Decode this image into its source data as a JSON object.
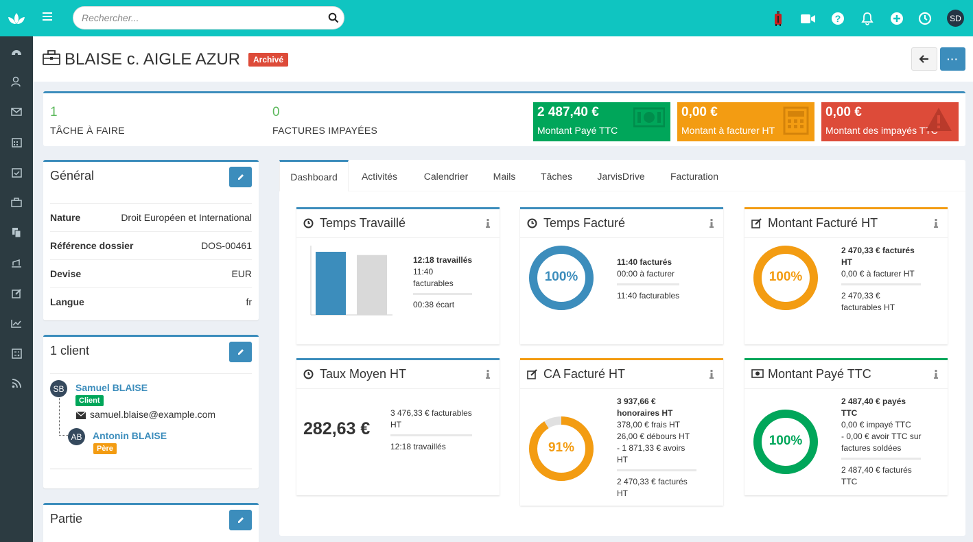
{
  "search": {
    "placeholder": "Rechercher..."
  },
  "header": {
    "title": "BLAISE c. AIGLE AZUR",
    "badge": "Archivé",
    "avatar": "SD",
    "more_label": "···"
  },
  "stats": {
    "tasks": {
      "value": "1",
      "label": "TÂCHE À FAIRE"
    },
    "invoices": {
      "value": "0",
      "label": "FACTURES IMPAYÉES"
    },
    "paid": {
      "amount": "2 487,40 €",
      "label": "Montant Payé TTC",
      "color": "#00a65a"
    },
    "to_bill": {
      "amount": "0,00 €",
      "label": "Montant à facturer HT",
      "color": "#f39c12"
    },
    "unpaid": {
      "amount": "0,00 €",
      "label": "Montant des impayés TTC",
      "color": "#dd4b39"
    }
  },
  "general": {
    "title": "Général",
    "rows": [
      {
        "k": "Nature",
        "v": "Droit Européen et International"
      },
      {
        "k": "Référence dossier",
        "v": "DOS-00461"
      },
      {
        "k": "Devise",
        "v": "EUR"
      },
      {
        "k": "Langue",
        "v": "fr"
      }
    ]
  },
  "clients": {
    "title": "1 client",
    "client": {
      "initials": "SB",
      "name": "Samuel BLAISE",
      "tag": "Client",
      "email": "samuel.blaise@example.com"
    },
    "relative": {
      "initials": "AB",
      "name": "Antonin BLAISE",
      "tag": "Père"
    }
  },
  "partie": {
    "title": "Partie"
  },
  "tabs": [
    "Dashboard",
    "Activités",
    "Calendrier",
    "Mails",
    "Tâches",
    "JarvisDrive",
    "Facturation"
  ],
  "cards": {
    "temps_travaille": {
      "title": "Temps Travaillé",
      "l1": "12:18 travaillés",
      "l2": "11:40",
      "l3": "facturables",
      "l4": "00:38 écart",
      "bars": [
        12.3,
        11.67
      ]
    },
    "temps_facture": {
      "title": "Temps Facturé",
      "pct": "100%",
      "pct_value": 100,
      "l1": "11:40 facturés",
      "l2": "00:00 à facturer",
      "l3": "11:40 facturables"
    },
    "montant_facture": {
      "title": "Montant Facturé HT",
      "pct": "100%",
      "pct_value": 100,
      "l1": "2 470,33 € facturés",
      "l1b": "HT",
      "l2": "0,00 € à facturer HT",
      "l3": "2 470,33 €",
      "l4": "facturables HT"
    },
    "taux_moyen": {
      "title": "Taux Moyen HT",
      "big": "282,63 €",
      "l1": "3 476,33 € facturables",
      "l1b": "HT",
      "l2": "12:18 travaillés"
    },
    "ca_facture": {
      "title": "CA Facturé HT",
      "pct": "91%",
      "pct_value": 91,
      "l1": "3 937,66 €",
      "l1b": "honoraires HT",
      "l2": "378,00 € frais HT",
      "l3": "26,00 € débours HT",
      "l4": "- 1 871,33 € avoirs",
      "l4b": "HT",
      "l5": "2 470,33 € facturés",
      "l5b": "HT"
    },
    "montant_paye": {
      "title": "Montant Payé TTC",
      "pct": "100%",
      "pct_value": 100,
      "l1": "2 487,40 € payés",
      "l1b": "TTC",
      "l2": "0,00 € impayé TTC",
      "l3": "- 0,00 € avoir TTC sur",
      "l4": "factures soldées",
      "l5": "2 487,40 € facturés",
      "l5b": "TTC"
    }
  }
}
